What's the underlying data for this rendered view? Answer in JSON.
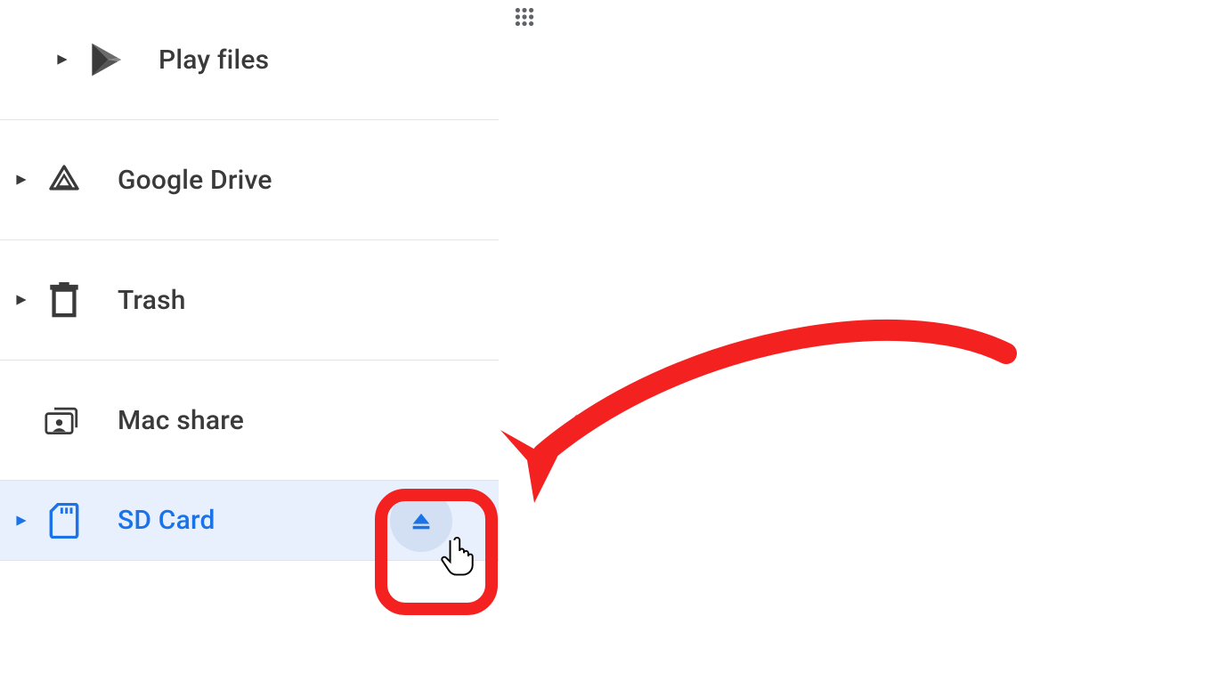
{
  "header": {
    "grid_icon": "apps-grid-icon"
  },
  "sidebar": {
    "items": [
      {
        "label": "Play files",
        "icon": "play-store-icon",
        "expandable": true,
        "selected": false
      },
      {
        "label": "Google Drive",
        "icon": "drive-icon",
        "expandable": true,
        "selected": false
      },
      {
        "label": "Trash",
        "icon": "trash-icon",
        "expandable": true,
        "selected": false
      },
      {
        "label": "Mac share",
        "icon": "smb-share-icon",
        "expandable": false,
        "selected": false
      },
      {
        "label": "SD Card",
        "icon": "sd-card-icon",
        "expandable": true,
        "selected": true,
        "ejectable": true
      }
    ]
  },
  "annotation": {
    "highlight_target": "eject-button",
    "arrow_color": "#f42121"
  },
  "colors": {
    "accent": "#1a73e8",
    "selection_bg": "#e8f0fe",
    "annotation": "#f42121"
  }
}
